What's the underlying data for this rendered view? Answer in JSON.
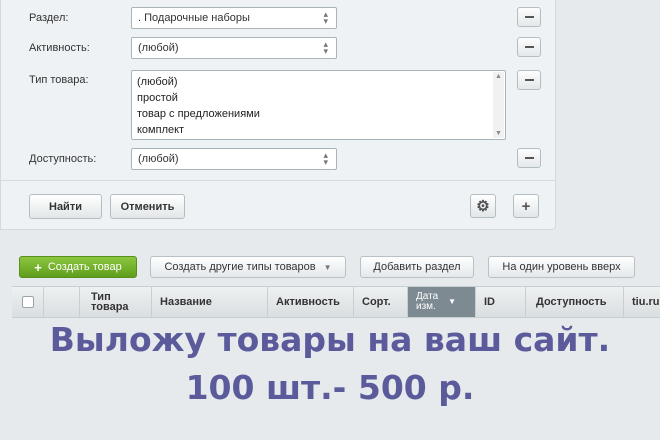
{
  "filter": {
    "section": {
      "label": "Раздел:",
      "value": ". Подарочные наборы"
    },
    "activity": {
      "label": "Активность:",
      "value": "(любой)"
    },
    "product_type": {
      "label": "Тип товара:",
      "options": [
        "(любой)",
        "простой",
        "товар с предложениями",
        "комплект"
      ]
    },
    "availability": {
      "label": "Доступность:",
      "value": "(любой)"
    },
    "find_label": "Найти",
    "cancel_label": "Отменить"
  },
  "toolbar": {
    "create_label": "Создать товар",
    "create_other_label": "Создать другие типы товаров",
    "add_section_label": "Добавить раздел",
    "level_up_label": "На один уровень вверх"
  },
  "table": {
    "headers": {
      "type_line1": "Тип",
      "type_line2": "товара",
      "name": "Название",
      "activity": "Активность",
      "sort": "Сорт.",
      "date_line1": "Дата",
      "date_line2": "изм.",
      "id": "ID",
      "availability": "Доступность",
      "tiu": "tiu.ru"
    }
  },
  "promo": {
    "line1": "Выложу товары на ваш сайт.",
    "line2": "100 шт.- 500 р."
  },
  "colors": {
    "primary_green": "#6fae2a",
    "promo_text": "#5b5b9c",
    "sorted_header": "#7e8a92"
  }
}
